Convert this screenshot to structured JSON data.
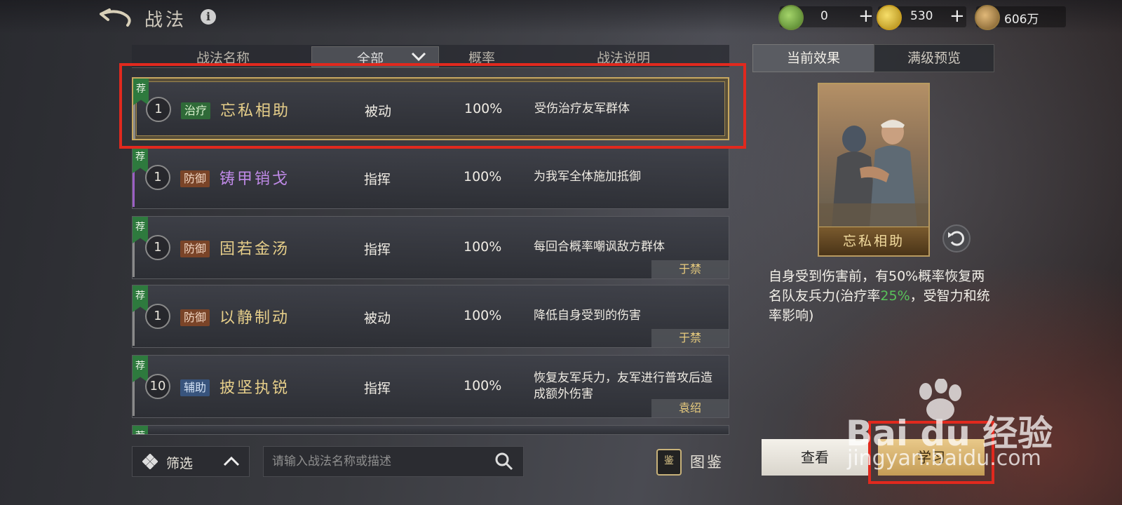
{
  "header": {
    "title": "战法",
    "info_icon": "info-icon",
    "back_icon": "back-arrow-icon"
  },
  "currencies": [
    {
      "name": "jade",
      "value": "0",
      "plus": "+",
      "color": "#7ab24a"
    },
    {
      "name": "gold",
      "value": "530",
      "plus": "+",
      "color": "#d4b22a"
    },
    {
      "name": "copper",
      "value": "606万",
      "color": "#b08a4a"
    }
  ],
  "table": {
    "columns": [
      "战法名称",
      "全部",
      "概率",
      "战法说明"
    ],
    "rows": [
      {
        "recommended": "荐",
        "level": "1",
        "tag": "治疗",
        "tag_type": "heal",
        "name": "忘私相助",
        "name_color": "gold",
        "type": "被动",
        "prob": "100%",
        "desc": "受伤治疗友军群体",
        "owner": "",
        "selected": true
      },
      {
        "recommended": "荐",
        "level": "1",
        "tag": "防御",
        "tag_type": "def",
        "name": "铸甲销戈",
        "name_color": "purple",
        "type": "指挥",
        "prob": "100%",
        "desc": "为我军全体施加抵御",
        "owner": "",
        "selected": false
      },
      {
        "recommended": "荐",
        "level": "1",
        "tag": "防御",
        "tag_type": "def",
        "name": "固若金汤",
        "name_color": "gold",
        "type": "指挥",
        "prob": "100%",
        "desc": "每回合概率嘲讽敌方群体",
        "owner": "于禁",
        "selected": false
      },
      {
        "recommended": "荐",
        "level": "1",
        "tag": "防御",
        "tag_type": "def",
        "name": "以静制动",
        "name_color": "gold",
        "type": "被动",
        "prob": "100%",
        "desc": "降低自身受到的伤害",
        "owner": "于禁",
        "selected": false
      },
      {
        "recommended": "荐",
        "level": "10",
        "tag": "辅助",
        "tag_type": "aux",
        "name": "披坚执锐",
        "name_color": "gold",
        "type": "指挥",
        "prob": "100%",
        "desc": "恢复友军兵力，友军进行普攻后造成额外伤害",
        "owner": "袁绍",
        "selected": false
      }
    ]
  },
  "bottom": {
    "filter_label": "筛选",
    "search_placeholder": "请输入战法名称或描述",
    "atlas_label": "图鉴",
    "atlas_icon_char": "鉴"
  },
  "detail": {
    "tabs": [
      "当前效果",
      "满级预览"
    ],
    "card_name": "忘私相助",
    "effect_part1": "自身受到伤害前，有50%概率恢复两名队友兵力(治疗率",
    "effect_highlight": "25%",
    "effect_part2": "，受智力和统率影响)",
    "view_label": "查看",
    "learn_label": "学习"
  },
  "watermark": {
    "brand": "Bai du 经验",
    "url": "jingyan.baidu.com"
  }
}
